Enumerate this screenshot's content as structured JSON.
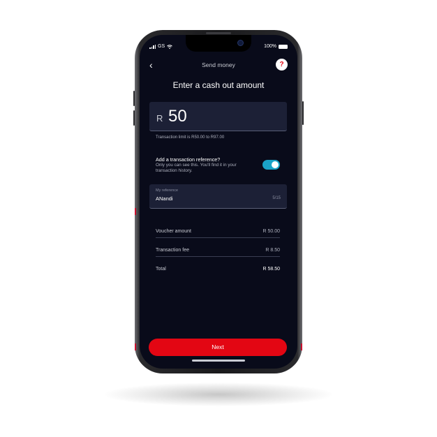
{
  "status_bar": {
    "carrier": "GS",
    "wifi": "wifi-icon",
    "battery_text": "100%"
  },
  "nav": {
    "back_icon": "‹",
    "title": "Send money",
    "help_icon": "?"
  },
  "page": {
    "title": "Enter a cash out amount"
  },
  "amount": {
    "currency": "R",
    "value": "50"
  },
  "limit_text": "Transaction limit is R50.00 to R97.00",
  "reference_toggle": {
    "title": "Add a transaction reference?",
    "description": "Only you can see this. You'll find it in your transaction history.",
    "enabled": true
  },
  "reference_field": {
    "label": "My reference",
    "value": "ANandi",
    "counter": "5/15"
  },
  "summary": [
    {
      "label": "Voucher amount",
      "value": "R 50.00"
    },
    {
      "label": "Transaction fee",
      "value": "R 8.50"
    },
    {
      "label": "Total",
      "value": "R 58.50"
    }
  ],
  "actions": {
    "next_label": "Next"
  },
  "colors": {
    "screen_bg": "#090b1a",
    "accent_red": "#e30613",
    "toggle_on": "#1aa3c7",
    "field_bg": "#1c2036"
  }
}
